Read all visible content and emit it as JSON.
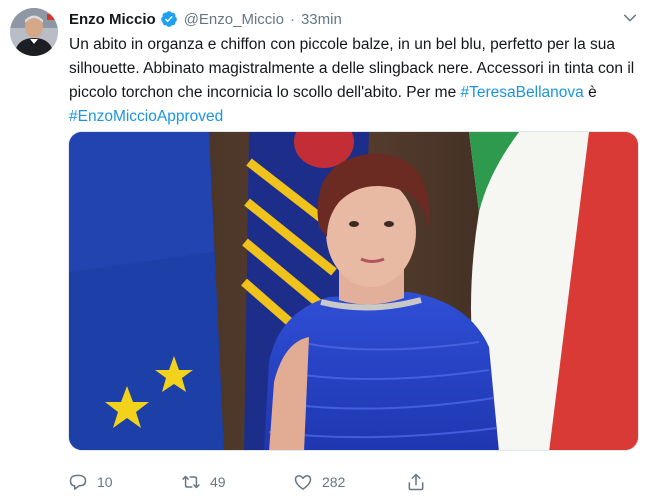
{
  "tweet": {
    "author_name": "Enzo Miccio",
    "handle": "@Enzo_Miccio",
    "separator": "·",
    "timestamp": "33min",
    "text_plain": "Un abito in organza e chiffon con piccole balze, in un bel blu, perfetto per la sua silhouette. Abbinato magistralmente a delle slingback nere. Accessori in tinta con il piccolo torchon che incornicia lo scollo dell'abito. Per me ",
    "hashtag_1": "#TeresaBellanova",
    "connector": " è ",
    "hashtag_2": "#EnzoMiccioApproved"
  },
  "actions": {
    "reply_count": "10",
    "retweet_count": "49",
    "like_count": "282"
  },
  "icons": {
    "verified": "verified-badge-icon",
    "caret": "chevron-down-icon",
    "reply": "reply-icon",
    "retweet": "retweet-icon",
    "like": "heart-icon",
    "share": "share-icon"
  },
  "colors": {
    "link": "#1b95e0",
    "secondary_text": "#657786",
    "primary_text": "#14171a",
    "verified": "#1da1f2"
  }
}
